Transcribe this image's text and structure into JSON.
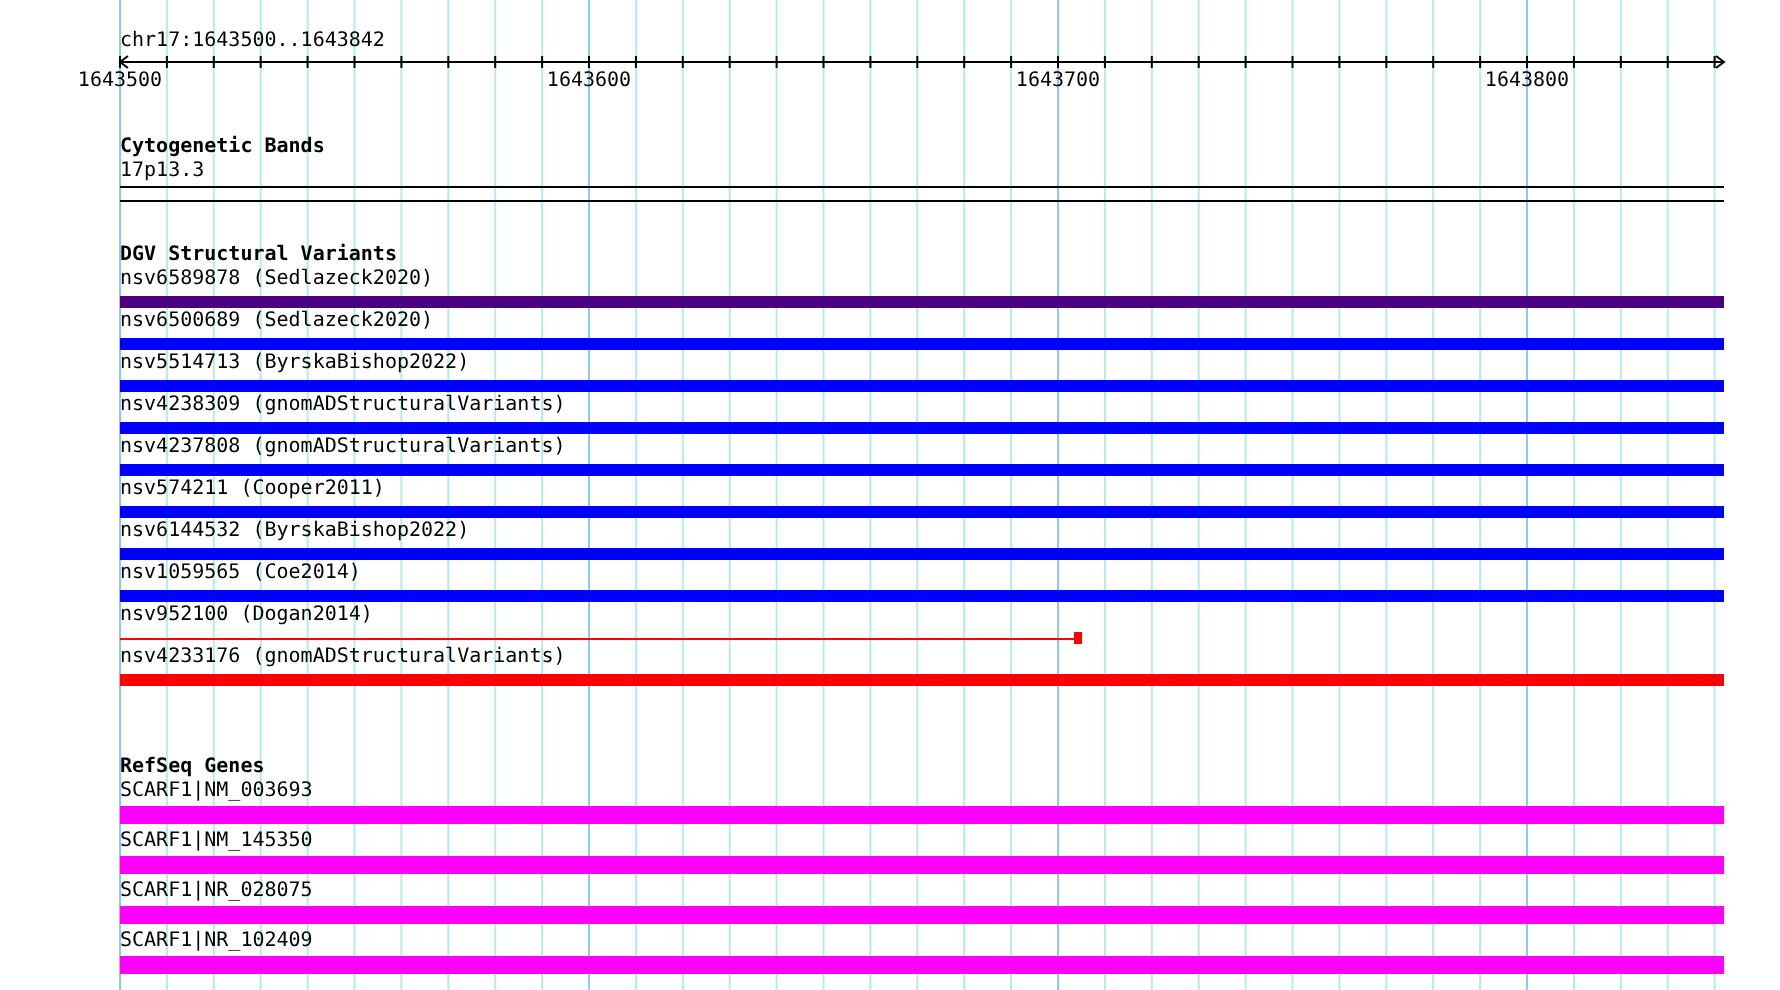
{
  "ruler": {
    "location": "chr17:1643500..1643842",
    "labels": [
      "1643500",
      "1643600",
      "1643700",
      "1643800"
    ]
  },
  "tracks": [
    {
      "title": "Cytogenetic Bands",
      "features": [
        {
          "label": "17p13.3",
          "kind": "band"
        }
      ]
    },
    {
      "title": "DGV Structural Variants",
      "features": [
        {
          "label": "nsv6589878 (Sedlazeck2020)",
          "kind": "bar",
          "color": "#4b0082"
        },
        {
          "label": "nsv6500689 (Sedlazeck2020)",
          "kind": "bar",
          "color": "#0000ff"
        },
        {
          "label": "nsv5514713 (ByrskaBishop2022)",
          "kind": "bar",
          "color": "#0000ff"
        },
        {
          "label": "nsv4238309 (gnomADStructuralVariants)",
          "kind": "bar",
          "color": "#0000ff"
        },
        {
          "label": "nsv4237808 (gnomADStructuralVariants)",
          "kind": "bar",
          "color": "#0000ff"
        },
        {
          "label": "nsv574211 (Cooper2011)",
          "kind": "bar",
          "color": "#0000ff"
        },
        {
          "label": "nsv6144532 (ByrskaBishop2022)",
          "kind": "bar",
          "color": "#0000ff"
        },
        {
          "label": "nsv1059565 (Coe2014)",
          "kind": "bar",
          "color": "#0000ff"
        },
        {
          "label": "nsv952100 (Dogan2014)",
          "kind": "line",
          "color": "#ff0000",
          "level": 0.6
        },
        {
          "label": "nsv4233176 (gnomADStructuralVariants)",
          "kind": "bar",
          "color": "#ff0000"
        }
      ]
    },
    {
      "title": "RefSeq Genes",
      "features": [
        {
          "label": "SCARF1|NM_003693",
          "kind": "gene",
          "color": "#ff00ff"
        },
        {
          "label": "SCARF1|NM_145350",
          "kind": "gene",
          "color": "#ff00ff"
        },
        {
          "label": "SCARF1|NR_028075",
          "kind": "gene",
          "color": "#ff00ff"
        },
        {
          "label": "SCARF1|NR_102409",
          "kind": "gene",
          "color": "#ff00ff"
        }
      ]
    }
  ]
}
